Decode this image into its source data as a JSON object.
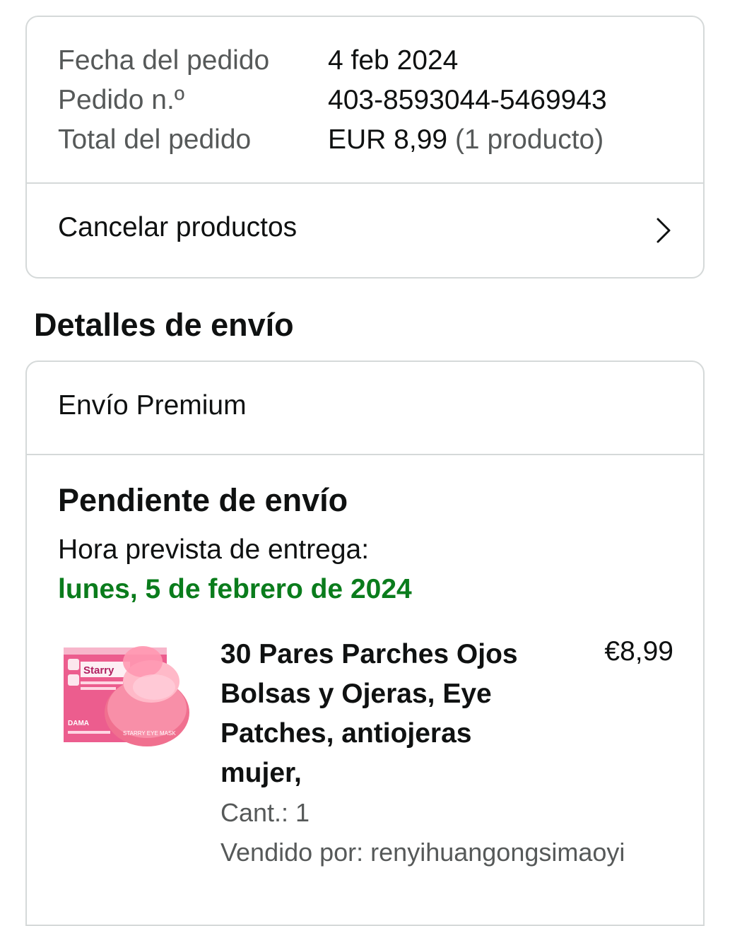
{
  "order": {
    "date_label": "Fecha del pedido",
    "date_value": "4 feb 2024",
    "number_label": "Pedido n.º",
    "number_value": "403-8593044-5469943",
    "total_label": "Total del pedido",
    "total_amount": "EUR 8,99",
    "total_count": "(1 producto)",
    "cancel_label": "Cancelar productos"
  },
  "shipping": {
    "section_title": "Detalles de envío",
    "method": "Envío Premium",
    "status": "Pendiente de envío",
    "eta_label": "Hora prevista de entrega:",
    "eta_date": "lunes, 5 de febrero de 2024"
  },
  "product": {
    "title": "30 Pares Parches Ojos Bolsas y Ojeras, Eye Patches, antiojeras mujer,",
    "price": "€8,99",
    "quantity": "Cant.: 1",
    "seller": "Vendido por: renyihuangongsimaoyi",
    "image_box_text": "Starry",
    "image_box_text2": "DAMA",
    "image_jar_text": "STARRY EYE MASK"
  },
  "colors": {
    "eta_green": "#0a7c1c",
    "border": "#d5d9d9",
    "muted_text": "#565959"
  },
  "icons": {
    "chevron": "chevron-right-icon"
  }
}
